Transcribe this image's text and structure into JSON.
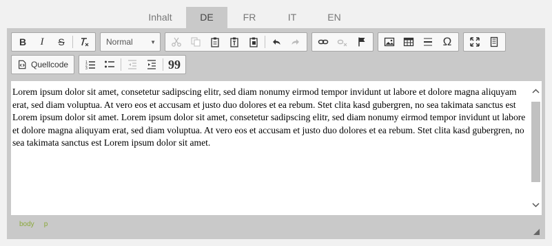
{
  "tabs": [
    {
      "label": "Inhalt"
    },
    {
      "label": "DE"
    },
    {
      "label": "FR"
    },
    {
      "label": "IT"
    },
    {
      "label": "EN"
    }
  ],
  "active_tab": "DE",
  "toolbar": {
    "format_combo": "Normal",
    "source_label": "Quellcode",
    "bold_label": "B",
    "italic_label": "I",
    "strike_label": "S",
    "special_char_label": "Ω",
    "blockquote_label": "99"
  },
  "content": {
    "text": "Lorem ipsum dolor sit amet, consetetur sadipscing elitr, sed diam nonumy eirmod tempor invidunt ut labore et dolore magna aliquyam erat, sed diam voluptua. At vero eos et accusam et justo duo dolores et ea rebum. Stet clita kasd gubergren, no sea takimata sanctus est Lorem ipsum dolor sit amet. Lorem ipsum dolor sit amet, consetetur sadipscing elitr, sed diam nonumy eirmod tempor invidunt ut labore et dolore magna aliquyam erat, sed diam voluptua. At vero eos et accusam et justo duo dolores et ea rebum. Stet clita kasd gubergren, no sea takimata sanctus est Lorem ipsum dolor sit amet."
  },
  "path": [
    "body",
    "p"
  ],
  "colors": {
    "accent": "#8aa83a",
    "frame": "#c9c9c9"
  }
}
